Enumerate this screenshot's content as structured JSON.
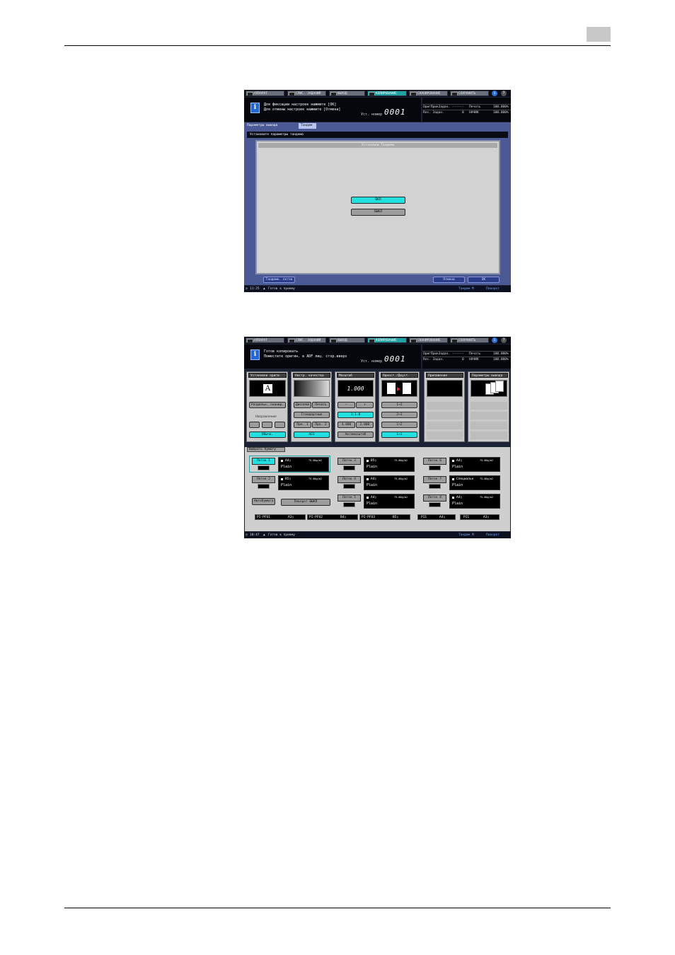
{
  "screen1": {
    "tabs": [
      "АППАРАТ",
      "СПИС. ЗАДАНИЙ",
      "ВЫХОД",
      "КОПИРОВАНИЕ",
      "СКАНИРОВАНИЕ",
      "СОХРАНИТЬ"
    ],
    "active_tab": "КОПИРОВАНИЕ",
    "message_line1": "Для фиксации настроек нажмите [OK]",
    "message_line2": "Для отмены настроек нажмите [Отмена]",
    "set_number_label": "Уст. номер",
    "set_number": "0001",
    "status": {
      "r1_left": "ОригПрикЗадан.",
      "r1_left_val": "------",
      "r1_right": "Печать",
      "r1_right_val": "100.000%",
      "r2_left": "Res. Задан.",
      "r2_left_val": "0",
      "r2_right": "НАЧИК",
      "r2_right_val": "100.000%"
    },
    "breadcrumb": "Параметры вывода",
    "breadcrumb_current": "Тандем",
    "instruction": "Установите параметры тандема",
    "panel_title": "Установки Тандема",
    "btn_on": "ВКЛ",
    "btn_off": "ВЫКЛ",
    "btn_tandem_paper": "Тандемн. лоток",
    "btn_cancel": "Отмена",
    "btn_ok": "OK",
    "time": "11:25",
    "status_text": "Готов к приему",
    "right_status_1": "Тандем М",
    "right_status_2": "Поворот"
  },
  "screen2": {
    "tabs": [
      "АППАРАТ",
      "СПИС. ЗАДАНИЙ",
      "ВЫХОД",
      "КОПИРОВАНИЕ",
      "СКАНИРОВАНИЕ",
      "СОХРАНИТЬ"
    ],
    "active_tab": "КОПИРОВАНИЕ",
    "message_line1": "Готов копировать",
    "message_line2": "Поместите оригин. в ADF лиц. стор.вверх",
    "set_number_label": "Уст. номер",
    "set_number": "0001",
    "status": {
      "r1_left": "ОригПрикЗадан.",
      "r1_left_val": "------",
      "r1_right": "Печать",
      "r1_right_val": "100.000%",
      "r2_left": "Res. Задан.",
      "r2_left_val": "0",
      "r2_right": "НАЧИК",
      "r2_right_val": "100.000%"
    },
    "sections": {
      "original": "Установки ориги.",
      "quality": "Настр. качества",
      "zoom": "Масштаб",
      "duplex": "Одност./Двуст.",
      "application": "Приложение",
      "output": "Параметры вывода"
    },
    "original_preview": "A",
    "btn_scan_sep": "Раздельн. сканир.",
    "direction_label": "Направление",
    "btn_orient": "Обычн.",
    "btn_text": "Дисплей",
    "btn_photo": "Печать",
    "btn_standard": "Стандартные",
    "btn_pre1": "Пре. 1",
    "btn_pre2": "Пре. 2",
    "btn_ae": "AES",
    "zoom_value": "1.000",
    "btn_minus": "−",
    "btn_plus": "+",
    "btn_zoom_11": "1:1.0",
    "btn_zoom_a": "4.000",
    "btn_zoom_b": "2.000",
    "btn_auto_zoom": "Автомасштаб",
    "duplex_options": [
      "1→2",
      "2→1",
      "1→2",
      "1→1"
    ],
    "paper_tab": "Выбрать бумагу",
    "trays": [
      {
        "label": "Лоток 1",
        "size": "A4▯",
        "weight": "75-80g/m2",
        "type": "Plain",
        "active": true
      },
      {
        "label": "Лоток 2",
        "size": "B5▯",
        "weight": "75-80g/m2",
        "type": "Plain",
        "active": false
      },
      {
        "label": "Лоток 3",
        "size": "B5▯",
        "weight": "75-80g/m2",
        "type": "Plain",
        "active": false
      },
      {
        "label": "Лоток 4",
        "size": "A4▯",
        "weight": "75-80g/m2",
        "type": "Plain",
        "active": false
      },
      {
        "label": "Лоток 5",
        "size": "A4▯",
        "weight": "75-80g/m2",
        "type": "Plain",
        "active": false
      },
      {
        "label": "Лоток 6",
        "size": "A4▯",
        "weight": "75-80g/m2",
        "type": "Plain",
        "active": false
      },
      {
        "label": "Лоток 7",
        "size": "Специальн",
        "weight": "75-80g/m2",
        "type": "Plain",
        "active": false
      },
      {
        "label": "Лоток 8",
        "size": "A4▯",
        "weight": "75-80g/m2",
        "type": "Plain",
        "active": false
      }
    ],
    "btn_auto_paper": "Автобумага",
    "btn_rotate": "Поворот ВЫКЛ",
    "pf_units": [
      {
        "name": "PI-PFU1",
        "size": "A3▯"
      },
      {
        "name": "PI-PFU2",
        "size": "B4▯"
      },
      {
        "name": "PI-PFU3",
        "size": "B5▯"
      },
      {
        "name": "PI1",
        "size": "A4▯"
      },
      {
        "name": "PI1",
        "size": "A3▯"
      }
    ],
    "time": "10:47",
    "status_text": "Готов к приему",
    "right_status_1": "Тандем М",
    "right_status_2": "Поворот"
  }
}
